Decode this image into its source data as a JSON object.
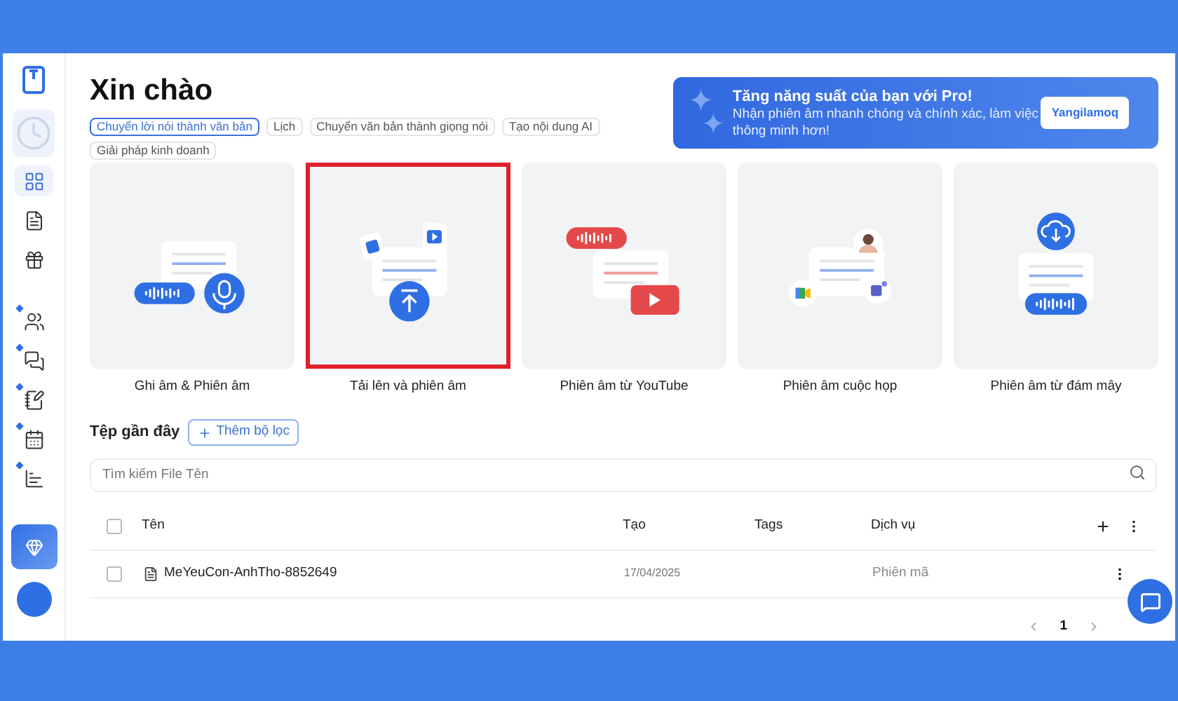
{
  "sidebar": {
    "items": [
      {
        "selected": true,
        "badge": false
      },
      {
        "selected": false,
        "badge": false
      },
      {
        "selected": false,
        "badge": false
      },
      {
        "selected": false,
        "badge": true
      },
      {
        "selected": false,
        "badge": true
      },
      {
        "selected": false,
        "badge": true
      },
      {
        "selected": false,
        "badge": true
      },
      {
        "selected": false,
        "badge": true
      }
    ]
  },
  "header": {
    "title": "Xin chào",
    "chips": [
      {
        "label": "Chuyển lời nói thành văn bản",
        "selected": true
      },
      {
        "label": "Lịch",
        "selected": false
      },
      {
        "label": "Chuyển văn bản thành giọng nói",
        "selected": false
      },
      {
        "label": "Tạo nội dung AI",
        "selected": false
      },
      {
        "label": "Giải pháp kinh doanh",
        "selected": false
      }
    ]
  },
  "promo": {
    "title": "Tăng năng suất của bạn với Pro!",
    "text": "Nhận phiên âm nhanh chóng và chính xác, làm việc thông minh hơn!",
    "button": "Yangilamoq"
  },
  "cards": [
    {
      "kind": "record",
      "label": "Ghi âm & Phiên âm",
      "highlighted": false
    },
    {
      "kind": "upload",
      "label": "Tải lên và phiên âm",
      "highlighted": true
    },
    {
      "kind": "youtube",
      "label": "Phiên âm từ YouTube",
      "highlighted": false
    },
    {
      "kind": "meeting",
      "label": "Phiên âm cuộc họp",
      "highlighted": false
    },
    {
      "kind": "cloud",
      "label": "Phiên âm từ đám mây",
      "highlighted": false
    }
  ],
  "recent": {
    "title": "Tệp gần đây",
    "filter_button": "Thêm bộ lọc",
    "search": {
      "placeholder": "Tìm kiếm File Tên"
    },
    "table": {
      "all_checked": false,
      "columns": [
        "Tên",
        "Tạo",
        "Tags",
        "Dịch vụ"
      ],
      "rows": [
        {
          "checked": false,
          "name": "MeYeuCon-AnhTho-8852649",
          "created": "17/04/2025",
          "service": "Phiên mã"
        }
      ]
    },
    "pagination": {
      "pages": [
        {
          "label": "1",
          "selected": true
        }
      ]
    }
  }
}
